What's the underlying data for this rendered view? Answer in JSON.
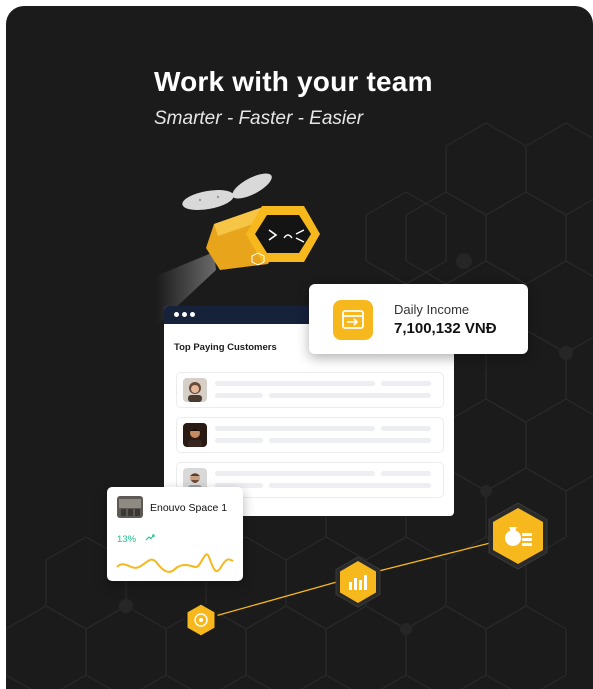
{
  "hero": {
    "title": "Work with your team",
    "subtitle": "Smarter - Faster - Easier"
  },
  "window": {
    "title": "Top Paying Customers",
    "rows": [
      {
        "avatar": "person-avatar-female"
      },
      {
        "avatar": "person-avatar-male"
      },
      {
        "avatar": "person-avatar-bearded"
      }
    ]
  },
  "income": {
    "label": "Daily Income",
    "value": "7,100,132 VNĐ",
    "icon": "transfer-icon"
  },
  "space": {
    "name": "Enouvo Space 1",
    "growth": "13%",
    "trend_icon": "trend-up-icon"
  },
  "growth_path": {
    "nodes": [
      "money-cycle-icon",
      "bar-chart-icon",
      "money-bag-icon"
    ]
  },
  "colors": {
    "background": "#1b1b1b",
    "accent": "#f7b81e",
    "window_bar": "#16213a",
    "positive": "#1fc28a"
  }
}
